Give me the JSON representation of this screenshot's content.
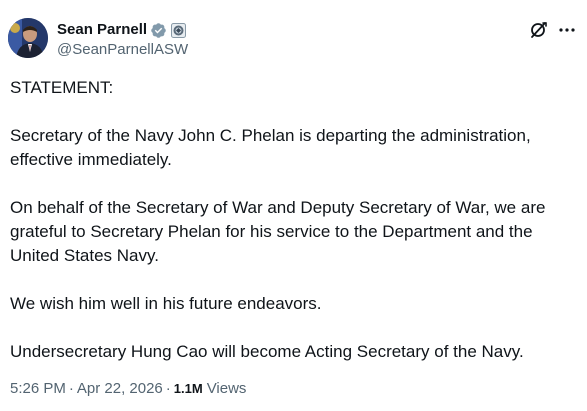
{
  "author": {
    "display_name": "Sean Parnell",
    "handle": "@SeanParnellASW",
    "verified_icon": "verified-badge-icon",
    "affiliate_icon": "government-seal-icon"
  },
  "header_actions": {
    "grok_icon": "grok-icon",
    "more_icon": "more-icon"
  },
  "post": {
    "paragraphs": [
      "STATEMENT:",
      "Secretary of the Navy John C. Phelan is departing the administration, effective immediately.",
      "On behalf of the Secretary of War and Deputy Secretary of War, we are grateful to Secretary Phelan for his service to the Department and the United States Navy.",
      "We wish him well in his future endeavors.",
      "Undersecretary Hung Cao will become Acting Secretary of the Navy."
    ]
  },
  "meta": {
    "time": "5:26 PM",
    "separator": "·",
    "date": "Apr 22, 2026",
    "views_count": "1.1M",
    "views_label": "Views"
  },
  "colors": {
    "text_primary": "#0f1419",
    "text_secondary": "#536471",
    "verified_blue": "#829aab"
  }
}
